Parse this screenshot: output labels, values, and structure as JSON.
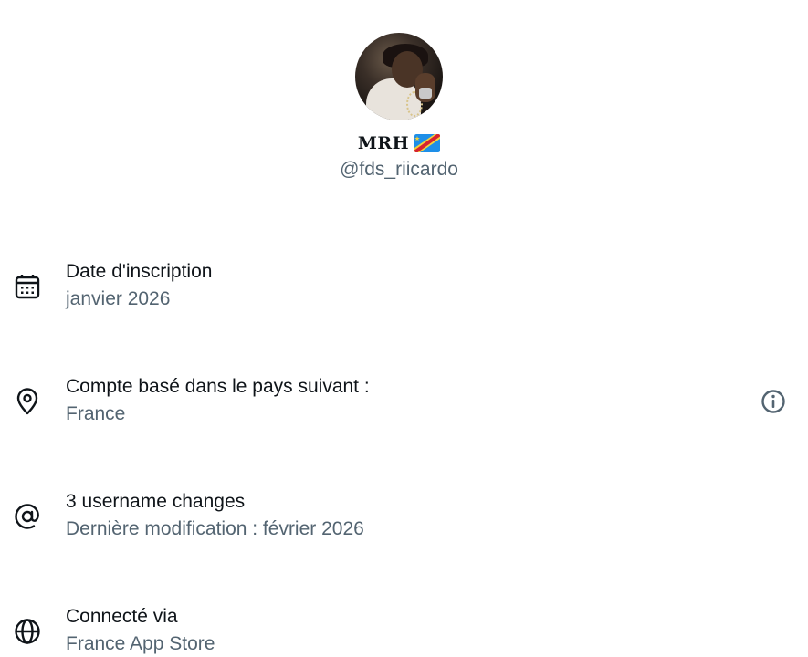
{
  "profile": {
    "display_name": "MRH",
    "flag_icon": "flag-dr-congo-icon",
    "handle": "@fds_riicardo"
  },
  "details": [
    {
      "icon": "calendar-icon",
      "label": "Date d'inscription",
      "value": "janvier 2026"
    },
    {
      "icon": "location-pin-icon",
      "label": "Compte basé dans le pays suivant :",
      "value": "France",
      "action_icon": "info-icon"
    },
    {
      "icon": "at-sign-icon",
      "label": "3 username changes",
      "value": "Dernière modification : février 2026"
    },
    {
      "icon": "globe-icon",
      "label": "Connecté via",
      "value": "France App Store"
    }
  ],
  "colors": {
    "primary_text": "#0f1419",
    "secondary_text": "#536471",
    "background": "#ffffff"
  }
}
